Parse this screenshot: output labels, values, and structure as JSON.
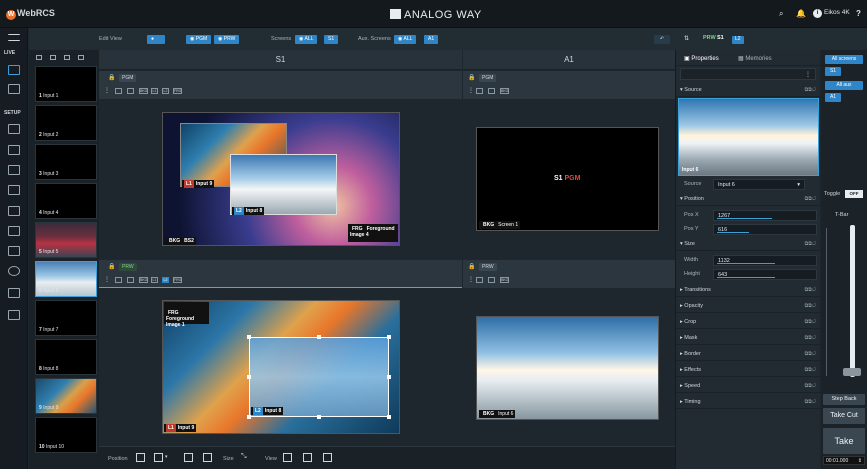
{
  "app": {
    "logo": "WebRCS",
    "logo_mark": "W",
    "brand": "ANALOG WAY",
    "device": "Eikos 4K",
    "help": "?"
  },
  "nav": {
    "live": "LIVE",
    "setup": "SETUP"
  },
  "toolbar": {
    "edit_view": "Edit View",
    "pgm": "PGM",
    "prw": "PRW",
    "screens_label": "Screens",
    "all": "ALL",
    "s1": "S1",
    "aux_label": "Aux. Screens",
    "aux_all": "ALL",
    "a1": "A1"
  },
  "inputs": [
    {
      "num": "1",
      "label": "Input 1"
    },
    {
      "num": "2",
      "label": "Input 2"
    },
    {
      "num": "3",
      "label": "Input 3"
    },
    {
      "num": "4",
      "label": "Input 4"
    },
    {
      "num": "5",
      "label": "Input 5"
    },
    {
      "num": "6",
      "label": "Input 6"
    },
    {
      "num": "7",
      "label": "Input 7"
    },
    {
      "num": "8",
      "label": "Input 8"
    },
    {
      "num": "9",
      "label": "Input 9"
    },
    {
      "num": "10",
      "label": "Input 10"
    }
  ],
  "screens": {
    "s1_title": "S1",
    "a1_title": "A1",
    "pgm": "PGM",
    "prw": "PRW",
    "s1_pgm_bkg": "BKG",
    "s1_pgm_bkg_name": "BS2",
    "s1_pgm_l1": "L1",
    "s1_pgm_l1_name": "Input 9",
    "s1_pgm_l2": "L2",
    "s1_pgm_l2_name": "Input 8",
    "s1_pgm_frg": "FRG",
    "s1_pgm_frg_name": "Foreground Image 4",
    "a1_pgm_bkg": "BKG",
    "a1_pgm_bkg_name": "Screen 1",
    "a1_pgm_text_a": "S1",
    "a1_pgm_text_b": "PGM",
    "s1_prw_frg": "FRG",
    "s1_prw_frg_name": "Foreground Image 1",
    "s1_prw_l2": "L2",
    "s1_prw_l2_name": "Input 8",
    "s1_prw_l1": "L1",
    "s1_prw_l1_name": "Input 9",
    "a1_prw_bkg": "BKG",
    "a1_prw_bkg_name": "Input 6",
    "mini_bkg": "BKG",
    "mini_l1": "L1",
    "mini_l2": "L2",
    "mini_frg": "FRG"
  },
  "properties": {
    "prw": "PRW",
    "screen": "S1",
    "badge": "L2",
    "tab_properties": "Properties",
    "tab_memories": "Memories",
    "source_header": "Source",
    "source_thumb": "Input 6",
    "source_label": "Source",
    "source_value": "Input 6",
    "position_header": "Position",
    "pos_x_label": "Pos X",
    "pos_x": "1267",
    "pos_y_label": "Pos Y",
    "pos_y": "616",
    "size_header": "Size",
    "width_label": "Width",
    "width": "1132",
    "height_label": "Height",
    "height": "643",
    "sections": [
      "Transitions",
      "Opacity",
      "Crop",
      "Mask",
      "Border",
      "Effects",
      "Speed",
      "Timing"
    ]
  },
  "right": {
    "all_screens": "All screens",
    "s1": "S1",
    "all_aux": "All aux",
    "a1": "A1",
    "toggle": "Toggle",
    "toggle_state": "OFF",
    "tbar": "T-Bar",
    "step_back": "Step Back",
    "take_cut": "Take Cut",
    "take": "Take",
    "duration": "00:01.000"
  },
  "bottom": {
    "position": "Position",
    "size": "Size",
    "view": "View"
  }
}
